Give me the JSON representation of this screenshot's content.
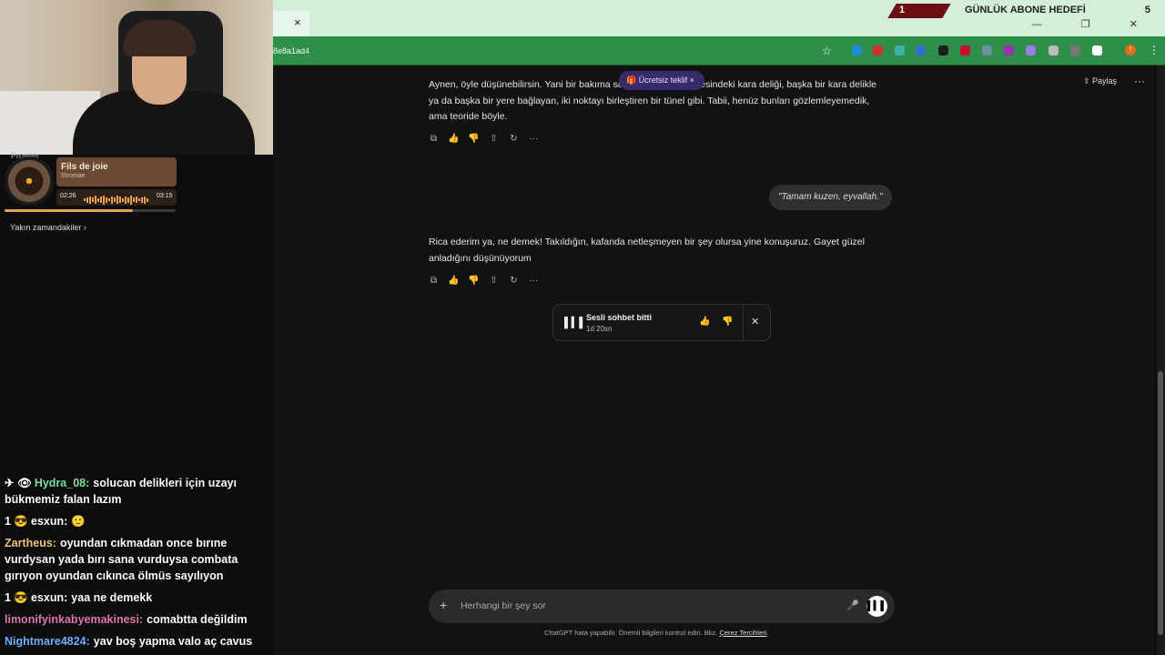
{
  "browser": {
    "url_fragment": "8e8a1ad4",
    "tab_close": "×",
    "star_glyph": "☆",
    "profile_initial": "!",
    "menu_glyph": "⋮",
    "ext_colors": [
      "#1d8fd8",
      "#d32f2f",
      "#3db1a8",
      "#2f6fd4",
      "#1e1e1e",
      "#c8102e",
      "#6b8fa3",
      "#9b2fb1",
      "#9b7de0",
      "#bbbbbb",
      "#777777",
      "#ffffff"
    ]
  },
  "stream_overlay": {
    "goal_current": "1",
    "goal_title": "GÜNLÜK ABONE HEDEFİ",
    "goal_target": "5"
  },
  "music_widget": {
    "projects_label": "Projeler",
    "song_title": "Fils de joie",
    "artist": "Stromae",
    "time_elapsed": "02:26",
    "time_total": "03:15",
    "progress_fraction": 0.75,
    "recent_label": "Yakın zamandakiler ›"
  },
  "chat": [
    {
      "icons": "✈ 👁",
      "user": "Hydra_08:",
      "color": "#7ee0a0",
      "text": "solucan delikleri için uzayı bükmemiz falan lazım"
    },
    {
      "icons": "1 😎",
      "user": "esxun:",
      "color": "#ffffff",
      "text": "🙂"
    },
    {
      "icons": "",
      "user": "Zartheus:",
      "color": "#f0c27a",
      "text": "oyundan cıkmadan once bırıne vurdysan yada bırı sana vurduysa combata gırıyon oyundan cıkınca ölmüs sayılıyon"
    },
    {
      "icons": "1 😎",
      "user": "esxun:",
      "color": "#ffffff",
      "text": "yaa ne demekk"
    },
    {
      "icons": "",
      "user": "limonifyinkabyemakinesi:",
      "color": "#e07ab0",
      "text": "comabtta değildim"
    },
    {
      "icons": "",
      "user": "Nightmare4824:",
      "color": "#6fb2ff",
      "text": "yav boş yapma valo aç cavus"
    }
  ],
  "header": {
    "share_label": "Paylaş",
    "more_glyph": "···"
  },
  "conversation": {
    "assistant_msg_1": "Aynen, öyle düşünebilirsin. Yani bir bakıma sanki evrenin bir köşesindeki kara deliği, başka bir kara delikle ya da başka bir yere bağlayan, iki noktayı birleştiren bir tünel gibi. Tabii, henüz bunları gözlemleyemedik, ama teoride böyle.",
    "user_msg": "\"Tamam kuzen, eyvallah.\"",
    "assistant_msg_2": "Rica ederim ya, ne demek! Takıldığın, kafanda netleşmeyen bir şey olursa yine konuşuruz. Gayet güzel anladığını düşünüyorum",
    "offer_pill": "🎁 Ücretsiz teklif  ×",
    "action_glyphs": [
      "⧉",
      "👍",
      "👎",
      "⇧",
      "↻",
      "···"
    ]
  },
  "voice_card": {
    "title": "Sesli sohbet bitti",
    "duration": "1d 20sn",
    "wave_glyph": "▌▍▌",
    "up_glyph": "👍",
    "down_glyph": "👎",
    "close_glyph": "✕"
  },
  "composer": {
    "placeholder": "Herhangi bir şey sor",
    "plus_glyph": "+",
    "mic_glyph": "🎤",
    "voice_glyph": "▌▍▌"
  },
  "footer": {
    "disclaimer": "ChatGPT hata yapabilir. Önemli bilgileri kontrol edin. Bkz.",
    "cookie_link": "Çerez Tercihleri",
    "disclaimer_end": "."
  }
}
